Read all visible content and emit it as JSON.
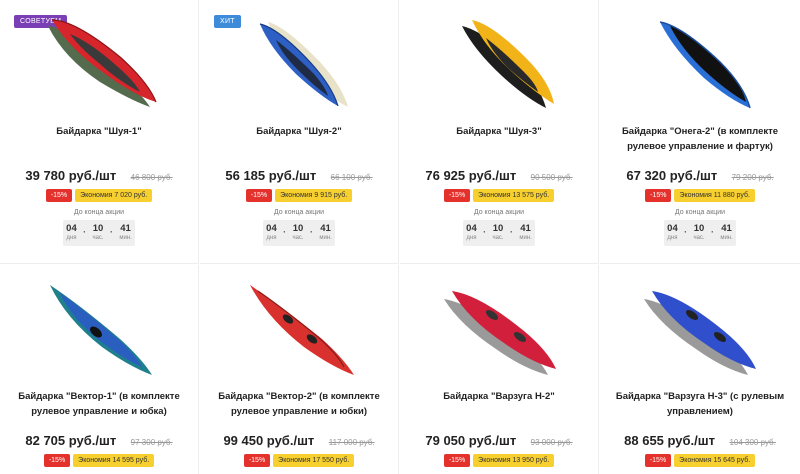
{
  "products": [
    {
      "badge": "Советуем",
      "badge_color": "#7b3fb5",
      "title": "Байдарка \"Шуя-1\"",
      "price": "39 780 руб./шт",
      "old_price": "46 800 руб.",
      "discount": "-15%",
      "economy": "Экономия 7 020 руб.",
      "until": "До конца акции",
      "timer": {
        "days": "04",
        "days_label": "дня",
        "hours": "10",
        "hours_label": "час.",
        "minutes": "41",
        "minutes_label": "мин."
      },
      "image": "kayak-red-green-icon"
    },
    {
      "badge": "Хит",
      "badge_color": "#3d8bd9",
      "title": "Байдарка \"Шуя-2\"",
      "price": "56 185 руб./шт",
      "old_price": "66 100 руб.",
      "discount": "-15%",
      "economy": "Экономия 9 915 руб.",
      "until": "До конца акции",
      "timer": {
        "days": "04",
        "days_label": "дня",
        "hours": "10",
        "hours_label": "час.",
        "minutes": "41",
        "minutes_label": "мин."
      },
      "image": "kayak-blue-beige-icon"
    },
    {
      "title": "Байдарка \"Шуя-3\"",
      "price": "76 925 руб./шт",
      "old_price": "90 500 руб.",
      "discount": "-15%",
      "economy": "Экономия 13 575 руб.",
      "until": "До конца акции",
      "timer": {
        "days": "04",
        "days_label": "дня",
        "hours": "10",
        "hours_label": "час.",
        "minutes": "41",
        "minutes_label": "мин."
      },
      "image": "kayak-yellow-black-icon"
    },
    {
      "title": "Байдарка \"Онега-2\" (в комплекте рулевое управление и фартук)",
      "price": "67 320 руб./шт",
      "old_price": "79 200 руб.",
      "discount": "-15%",
      "economy": "Экономия 11 880 руб.",
      "until": "До конца акции",
      "timer": {
        "days": "04",
        "days_label": "дня",
        "hours": "10",
        "hours_label": "час.",
        "minutes": "41",
        "minutes_label": "мин."
      },
      "image": "kayak-blue-black-icon"
    },
    {
      "title": "Байдарка \"Вектор-1\" (в комплекте рулевое управление и юбка)",
      "price": "82 705 руб./шт",
      "old_price": "97 300 руб.",
      "discount": "-15%",
      "economy": "Экономия 14 595 руб.",
      "image": "kayak-teal-blue-icon"
    },
    {
      "title": "Байдарка \"Вектор-2\" (в комплекте рулевое управление и юбки)",
      "price": "99 450 руб./шт",
      "old_price": "117 000 руб.",
      "discount": "-15%",
      "economy": "Экономия 17 550 руб.",
      "image": "kayak-red-single-icon"
    },
    {
      "title": "Байдарка \"Варзуга Н-2\"",
      "price": "79 050 руб./шт",
      "old_price": "93 000 руб.",
      "discount": "-15%",
      "economy": "Экономия 13 950 руб.",
      "image": "kayak-red-grey-icon"
    },
    {
      "title": "Байдарка \"Варзуга Н-3\" (с рулевым управлением)",
      "price": "88 655 руб./шт",
      "old_price": "104 300 руб.",
      "discount": "-15%",
      "economy": "Экономия 15 645 руб.",
      "image": "kayak-blue-grey-icon"
    }
  ],
  "colors": {
    "discount": "#e5312c",
    "economy": "#f7cf2e"
  }
}
